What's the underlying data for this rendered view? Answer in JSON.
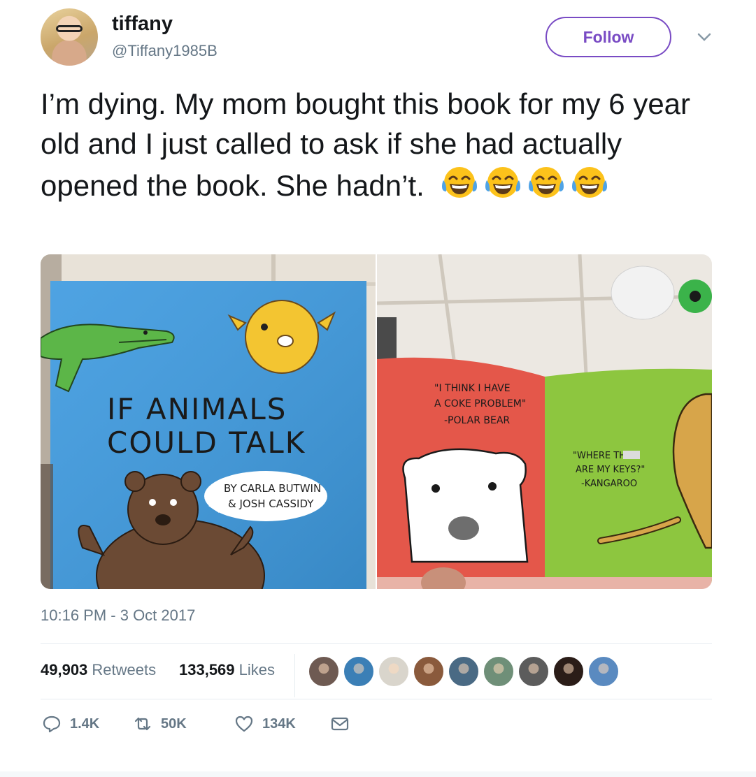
{
  "author": {
    "display_name": "tiffany",
    "handle": "@Tiffany1985B"
  },
  "follow_label": "Follow",
  "tweet_text": "I’m dying. My mom bought this book for my 6 year old and I just called to ask if she had actually opened the book. She hadn’t.",
  "emoji": [
    "face-with-tears-of-joy",
    "face-with-tears-of-joy",
    "face-with-tears-of-joy",
    "face-with-tears-of-joy"
  ],
  "photos": {
    "left": {
      "title_line1": "IF ANIMALS",
      "title_line2": "COULD TALK",
      "byline_line1": "BY CARLA BUTWIN",
      "byline_line2": "& JOSH CASSIDY",
      "colors": {
        "cover": "#3f9be0",
        "gator": "#5cb648",
        "pufferfish": "#f3c531",
        "bear": "#6b4a34"
      }
    },
    "right": {
      "quote_left_1": "\"I THINK I HAVE",
      "quote_left_2": "A COKE PROBLEM\"",
      "quote_left_3": "-POLAR BEAR",
      "quote_right_1": "\"WHERE THE",
      "quote_right_2": "ARE MY KEYS?\"",
      "quote_right_3": "-KANGAROO",
      "colors": {
        "red_page": "#e4574a",
        "green_page": "#8dc63f",
        "kangaroo": "#d7a54a"
      }
    }
  },
  "timestamp": "10:16 PM - 3 Oct 2017",
  "stats": {
    "retweets_count": "49,903",
    "retweets_label": "Retweets",
    "likes_count": "133,569",
    "likes_label": "Likes"
  },
  "likers": [
    "#6e5a52",
    "#3b7fb6",
    "#d9d5cc",
    "#8a5a3c",
    "#4a6a84",
    "#6f8f78",
    "#5c5c5c",
    "#2b1d18",
    "#5a8ac0"
  ],
  "actions": {
    "reply": {
      "icon": "reply-icon",
      "count": "1.4K"
    },
    "retweet": {
      "icon": "retweet-icon",
      "count": "50K"
    },
    "like": {
      "icon": "heart-icon",
      "count": "134K"
    },
    "dm": {
      "icon": "envelope-icon"
    }
  },
  "colors": {
    "accent": "#794bc4",
    "secondary_text": "#657786",
    "text": "#14171a",
    "divider": "#e6ecf0"
  }
}
